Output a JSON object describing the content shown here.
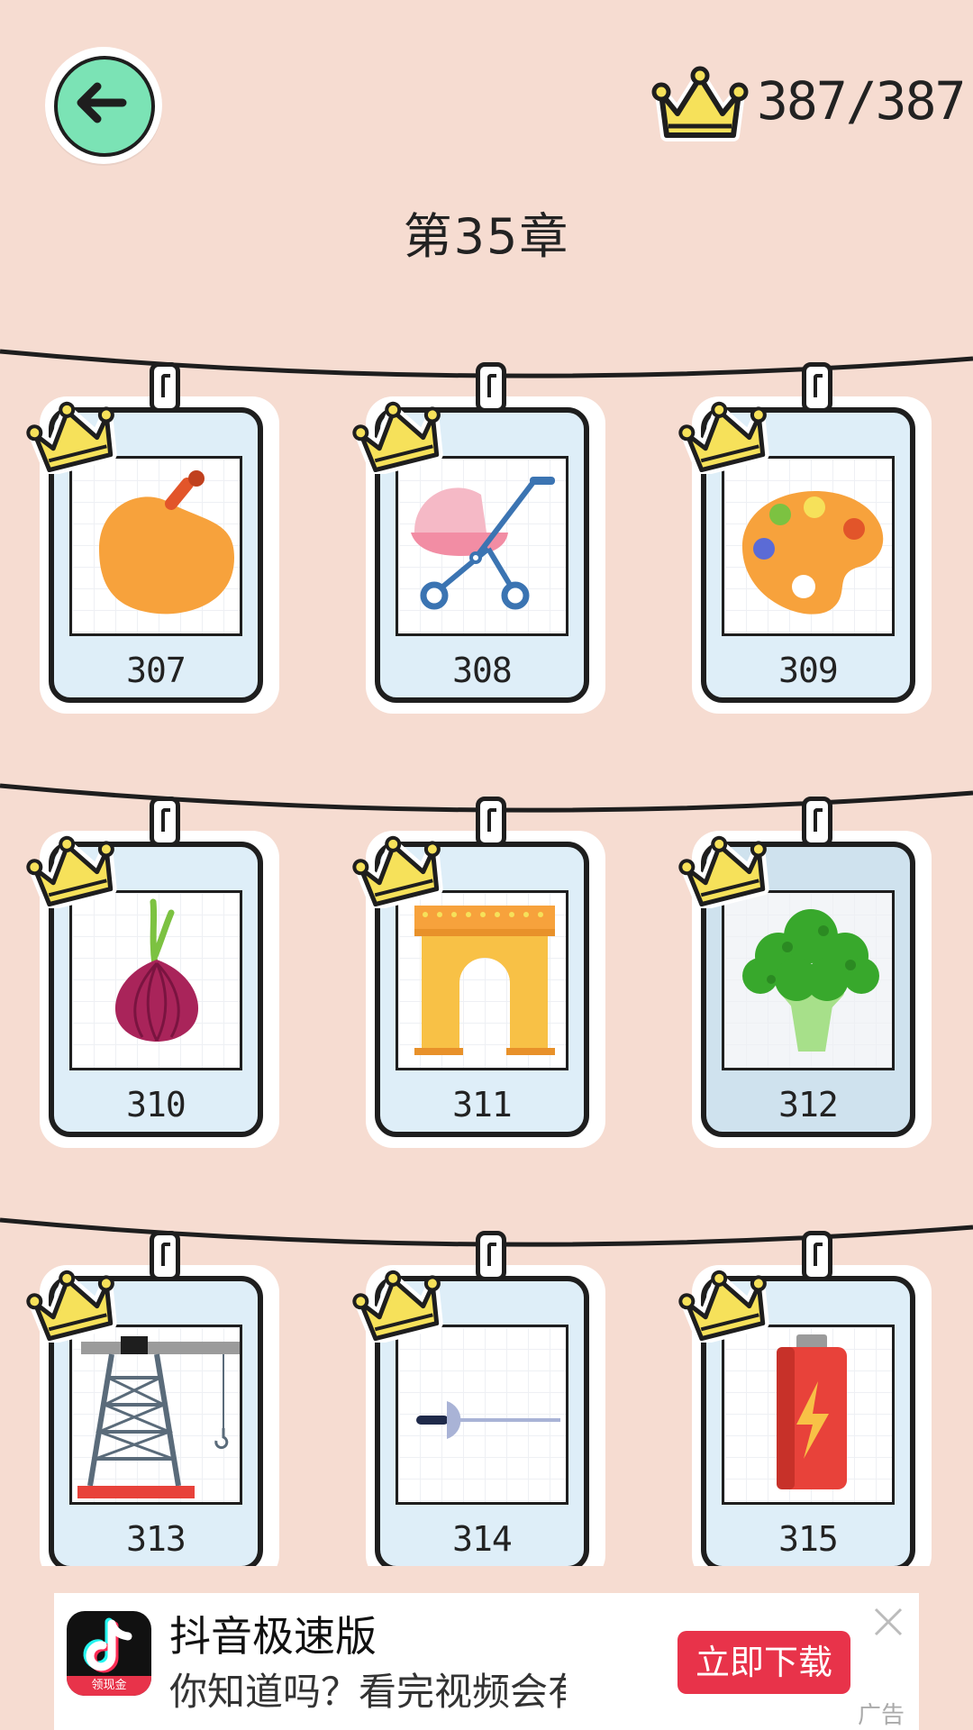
{
  "header": {
    "back_icon": "arrow-left-icon",
    "crown_icon": "crown-icon",
    "crown_count": "387/387",
    "chapter_title": "第35章"
  },
  "colors": {
    "background": "#f6dcd1",
    "back_button": "#7be3b5",
    "crown": "#f6e15a",
    "card_body": "#deeef8",
    "ad_cta": "#e8334a"
  },
  "levels": [
    {
      "number": "307",
      "item": "pumpkin",
      "completed": true
    },
    {
      "number": "308",
      "item": "baby-stroller",
      "completed": true
    },
    {
      "number": "309",
      "item": "paint-palette",
      "completed": true
    },
    {
      "number": "310",
      "item": "red-onion",
      "completed": true
    },
    {
      "number": "311",
      "item": "triumphal-arch",
      "completed": true
    },
    {
      "number": "312",
      "item": "broccoli",
      "completed": true
    },
    {
      "number": "313",
      "item": "tower-crane",
      "completed": true
    },
    {
      "number": "314",
      "item": "fencing-sword",
      "completed": true
    },
    {
      "number": "315",
      "item": "battery",
      "completed": true
    }
  ],
  "ad": {
    "app_name": "抖音极速版",
    "app_icon_tag": "领现金",
    "description": "你知道吗？看完视频会有...",
    "cta_label": "立即下载",
    "close_icon": "close-icon",
    "ad_label": "广告"
  }
}
